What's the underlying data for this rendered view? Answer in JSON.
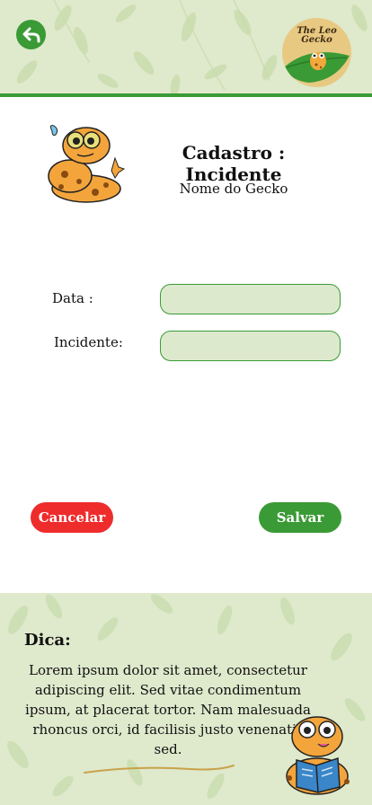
{
  "header": {
    "back_icon": "back-arrow-icon",
    "logo_text": "The Leo\nGecko",
    "colors": {
      "green": "#3a9a35",
      "header_bg": "#dfe9cc"
    }
  },
  "main": {
    "title": "Cadastro : Incidente",
    "subtitle": "Nome do Gecko"
  },
  "form": {
    "data_label": "Data :",
    "data_value": "",
    "incidente_label": "Incidente:",
    "incidente_value": ""
  },
  "actions": {
    "cancel_label": "Cancelar",
    "save_label": "Salvar",
    "colors": {
      "cancel": "#ee2c2c",
      "save": "#3a9a35"
    }
  },
  "tip": {
    "title": "Dica:",
    "text": "Lorem ipsum dolor sit amet, consectetur adipiscing elit. Sed vitae condimentum ipsum, at placerat tortor. Nam malesuada rhoncus orci, id facilisis justo venenatis sed."
  }
}
